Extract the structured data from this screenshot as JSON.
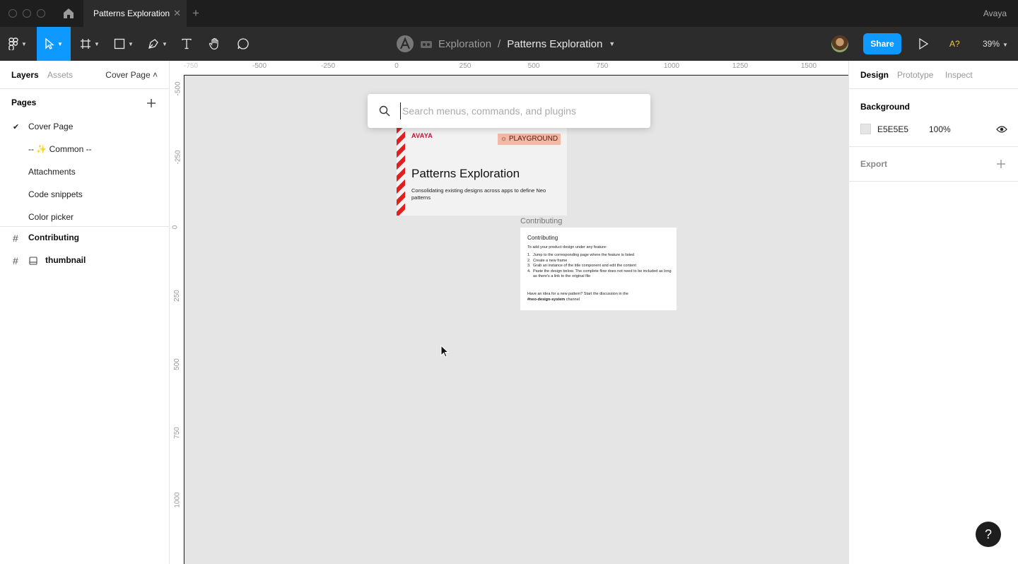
{
  "window": {
    "account": "Avaya"
  },
  "tab": {
    "title": "Patterns Exploration",
    "close": "✕",
    "new": "+"
  },
  "breadcrumb": {
    "project": "Exploration",
    "sep": "/",
    "file": "Patterns Exploration"
  },
  "toolbar": {
    "share_label": "Share",
    "a11y_label": "A?",
    "zoom": "39%"
  },
  "left_panel": {
    "tabs": [
      "Layers",
      "Assets"
    ],
    "current_page": "Cover Page ˄",
    "pages_header": "Pages",
    "pages": [
      "Cover Page",
      "-- ✨ Common --",
      "Attachments",
      "Code snippets",
      "Color picker"
    ],
    "layers": [
      "Contributing",
      "thumbnail"
    ]
  },
  "rulers": {
    "top": [
      "-750",
      "-500",
      "-250",
      "0",
      "250",
      "500",
      "750",
      "1000",
      "1250",
      "1500"
    ],
    "left": [
      "-500",
      "-250",
      "0",
      "250",
      "500",
      "750",
      "1000"
    ]
  },
  "search": {
    "placeholder": "Search menus, commands, and plugins",
    "value": ""
  },
  "cover": {
    "logo": "AVAYA",
    "badge": "PLAYGROUND",
    "title": "Patterns Exploration",
    "subtitle": "Consolidating existing designs across apps to define Neo patterns"
  },
  "contributing": {
    "label": "Contributing",
    "title": "Contributing",
    "intro": "To add your product design under any feature:",
    "steps": [
      "Jump to the corresponding page where the feature is listed",
      "Create a new frame",
      "Grab an instance of the title component and edit the content",
      "Paste the design below. The complete flow does not need to be included as long as there's a link to the original file"
    ],
    "footer_prefix": "Have an idea for a new pattern? Start the discussion in the",
    "footer_channel": "#neo-design-system",
    "footer_suffix": "channel"
  },
  "right_panel": {
    "tabs": [
      "Design",
      "Prototype",
      "Inspect"
    ],
    "background_header": "Background",
    "bg_hex": "E5E5E5",
    "bg_opacity": "100%",
    "export_header": "Export"
  },
  "help": "?",
  "colors": {
    "accent": "#0d99ff",
    "canvas": "#e5e5e5",
    "stripe": "#e02020",
    "badge": "#f2b9a6"
  }
}
